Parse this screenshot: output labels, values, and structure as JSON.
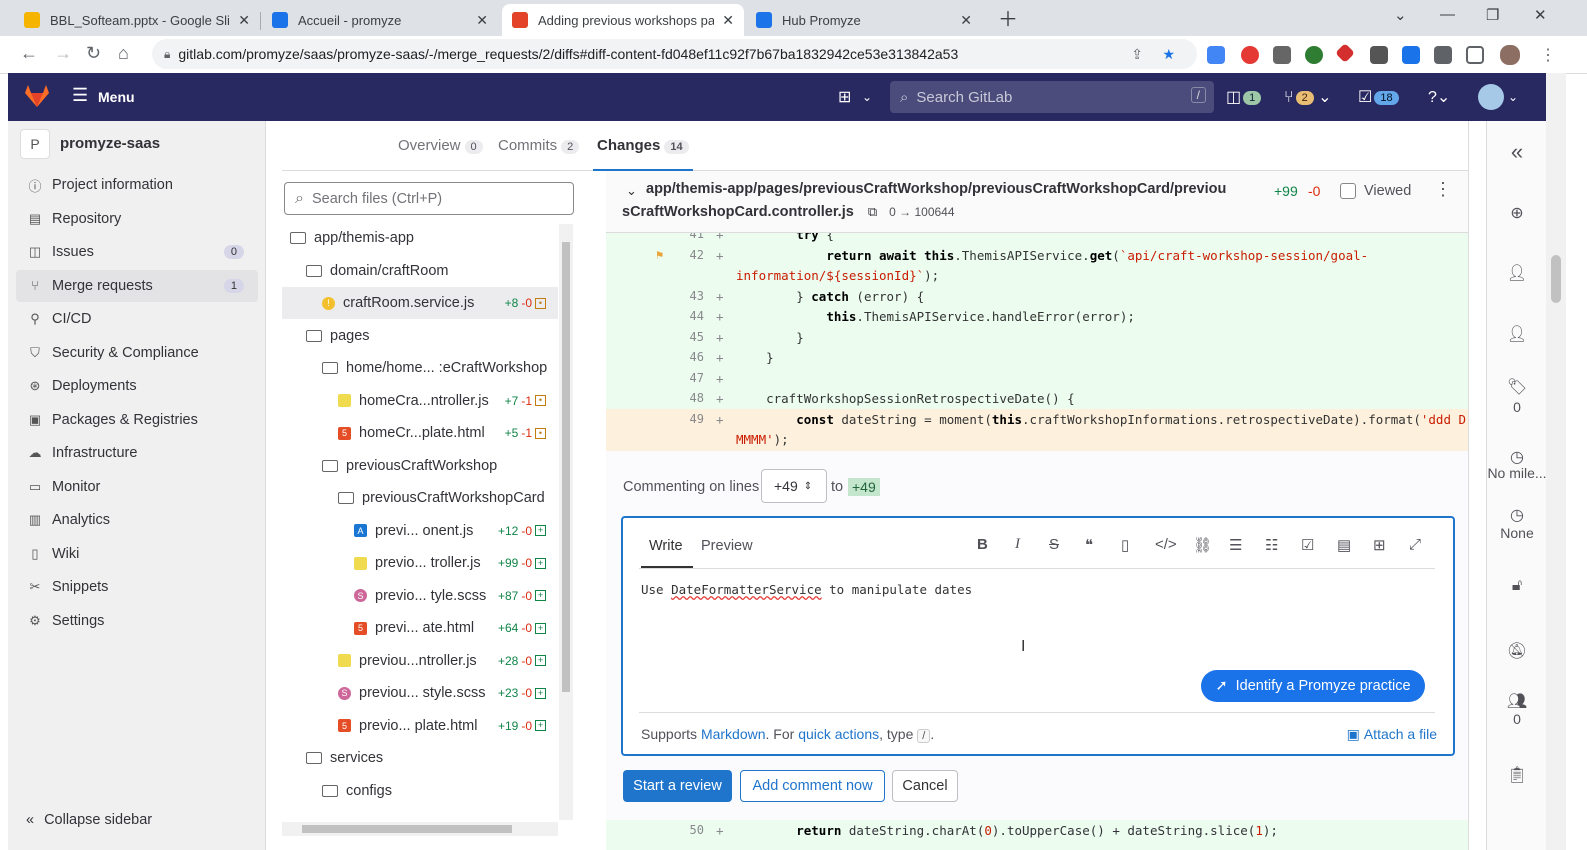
{
  "browser": {
    "tabs": [
      {
        "title": "BBL_Softeam.pptx - Google Slide",
        "active": false,
        "color": "#f4b400"
      },
      {
        "title": "Accueil - promyze",
        "active": false,
        "color": "#1a73e8"
      },
      {
        "title": "Adding previous workshops pag",
        "active": true,
        "color": "#e24329"
      },
      {
        "title": "Hub Promyze",
        "active": false,
        "color": "#1a73e8"
      }
    ],
    "url": "gitlab.com/promyze/saas/promyze-saas/-/merge_requests/2/diffs#diff-content-fd048ef11c92f7b67ba1832942ce53e313842a53"
  },
  "header": {
    "menu_label": "Menu",
    "search_placeholder": "Search GitLab",
    "search_shortcut": "/",
    "issues_count": "1",
    "mr_count": "2",
    "todos_count": "18"
  },
  "sidebar": {
    "project_initial": "P",
    "project_name": "promyze-saas",
    "items": [
      {
        "label": "Project information",
        "icon": "info-icon",
        "glyph": "ⓘ"
      },
      {
        "label": "Repository",
        "icon": "repository-icon",
        "glyph": "▤"
      },
      {
        "label": "Issues",
        "icon": "issues-icon",
        "glyph": "◫",
        "count": "0"
      },
      {
        "label": "Merge requests",
        "icon": "merge-request-icon",
        "glyph": "⑂",
        "count": "1",
        "active": true
      },
      {
        "label": "CI/CD",
        "icon": "rocket-icon",
        "glyph": "⚲"
      },
      {
        "label": "Security & Compliance",
        "icon": "shield-icon",
        "glyph": "⛉"
      },
      {
        "label": "Deployments",
        "icon": "deployments-icon",
        "glyph": "⊛"
      },
      {
        "label": "Packages & Registries",
        "icon": "package-icon",
        "glyph": "▣"
      },
      {
        "label": "Infrastructure",
        "icon": "cloud-icon",
        "glyph": "☁"
      },
      {
        "label": "Monitor",
        "icon": "monitor-icon",
        "glyph": "▭"
      },
      {
        "label": "Analytics",
        "icon": "chart-icon",
        "glyph": "▥"
      },
      {
        "label": "Wiki",
        "icon": "book-icon",
        "glyph": "▯"
      },
      {
        "label": "Snippets",
        "icon": "scissors-icon",
        "glyph": "✂"
      },
      {
        "label": "Settings",
        "icon": "gear-icon",
        "glyph": "⚙"
      }
    ],
    "collapse_label": "Collapse sidebar"
  },
  "mr_tabs": [
    {
      "label": "Overview",
      "count": "0"
    },
    {
      "label": "Commits",
      "count": "2"
    },
    {
      "label": "Changes",
      "count": "14",
      "active": true
    }
  ],
  "file_tree": {
    "search_placeholder": "Search files (Ctrl+P)",
    "rows": [
      {
        "type": "folder",
        "label": "app/themis-app",
        "indent": 0
      },
      {
        "type": "folder",
        "label": "domain/craftRoom",
        "indent": 1
      },
      {
        "type": "js",
        "label": "craftRoom.service.js",
        "indent": 2,
        "add": "+8",
        "del": "-0",
        "mod": true,
        "selected": true,
        "warn": true
      },
      {
        "type": "folder",
        "label": "pages",
        "indent": 1
      },
      {
        "type": "folder",
        "label": "home/home... :eCraftWorkshop",
        "indent": 2
      },
      {
        "type": "js",
        "label": "homeCra...ntroller.js",
        "indent": 3,
        "add": "+7",
        "del": "-1",
        "mod": true
      },
      {
        "type": "html",
        "label": "homeCr...plate.html",
        "indent": 3,
        "add": "+5",
        "del": "-1",
        "mod": true
      },
      {
        "type": "folder",
        "label": "previousCraftWorkshop",
        "indent": 2
      },
      {
        "type": "folder",
        "label": "previousCraftWorkshopCard",
        "indent": 3
      },
      {
        "type": "ng",
        "label": "previ... onent.js",
        "indent": 4,
        "add": "+12",
        "del": "-0"
      },
      {
        "type": "js",
        "label": "previo... troller.js",
        "indent": 4,
        "add": "+99",
        "del": "-0"
      },
      {
        "type": "scss",
        "label": "previo... tyle.scss",
        "indent": 4,
        "add": "+87",
        "del": "-0"
      },
      {
        "type": "html",
        "label": "previ... ate.html",
        "indent": 4,
        "add": "+64",
        "del": "-0"
      },
      {
        "type": "js",
        "label": "previou...ntroller.js",
        "indent": 3,
        "add": "+28",
        "del": "-0"
      },
      {
        "type": "scss",
        "label": "previou... style.scss",
        "indent": 3,
        "add": "+23",
        "del": "-0"
      },
      {
        "type": "html",
        "label": "previo... plate.html",
        "indent": 3,
        "add": "+19",
        "del": "-0"
      },
      {
        "type": "folder",
        "label": "services",
        "indent": 1
      },
      {
        "type": "folder",
        "label": "configs",
        "indent": 2
      }
    ]
  },
  "diff": {
    "path_line1": "app/themis-app/pages/previousCraftWorkshop/previousCraftWorkshopCard/previou",
    "path_line2": "sCraftWorkshopCard.controller.js",
    "mode": "0 → 100644",
    "added": "+99",
    "removed": "-0",
    "viewed_label": "Viewed",
    "lines": [
      {
        "n": "41",
        "html": "        <span class='kw'>try</span> {"
      },
      {
        "n": "42",
        "html": "            <span class='kw'>return await this</span>.ThemisAPIService.<span class='kw'>get</span>(<span class='str'>`api/craft-workshop-session/goal-</span>"
      },
      {
        "n": "",
        "html": "<span class='str'>information/${sessionId}`</span>);",
        "wrap": true
      },
      {
        "n": "43",
        "html": "        } <span class='kw'>catch</span> (error) {"
      },
      {
        "n": "44",
        "html": "            <span class='kw'>this</span>.ThemisAPIService.handleError(error);"
      },
      {
        "n": "45",
        "html": "        }"
      },
      {
        "n": "46",
        "html": "    }"
      },
      {
        "n": "47",
        "html": ""
      },
      {
        "n": "48",
        "html": "    craftWorkshopSessionRetrospectiveDate() {"
      },
      {
        "n": "49",
        "html": "        <span class='kw'>const</span> dateString = moment(<span class='kw'>this</span>.craftWorkshopInformations.retrospectiveDate).format(<span class='str'>'ddd D</span>"
      },
      {
        "n": "",
        "html": "<span class='str'>MMMM'</span>);",
        "wrap": true
      }
    ],
    "line50": {
      "n": "50",
      "html": "        <span class='kw'>return</span> dateString.charAt(<span class='str'>0</span>).toUpperCase() + dateString.slice(<span class='str'>1</span>);"
    }
  },
  "comment": {
    "commenting_label": "Commenting on lines",
    "from_line": "+49",
    "to_label": "to",
    "to_line": "+49",
    "write_tab": "Write",
    "preview_tab": "Preview",
    "text_prefix": "Use ",
    "text_underlined": "DateFormatterService",
    "text_suffix": " to manipulate dates",
    "promyze_button": "Identify a Promyze practice",
    "supports_prefix": "Supports ",
    "markdown_link": "Markdown",
    "for_text": ". For ",
    "quick_actions_link": "quick actions",
    "type_text": ", type",
    "slash": "/",
    "period": ".",
    "attach_label": "Attach a file",
    "start_review": "Start a review",
    "add_comment": "Add comment now",
    "cancel": "Cancel"
  },
  "right_sidebar": {
    "labels_count": "0",
    "milestone": "No mile...",
    "time_tracking": "None",
    "participants_count": "0"
  }
}
